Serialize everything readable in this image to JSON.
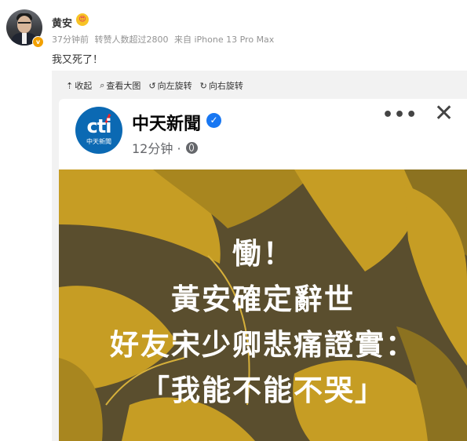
{
  "post": {
    "username": "黄安",
    "emoji_badge": "😍",
    "verified_mark": "v",
    "time": "37分钟前",
    "reposts": "转赞人数超过2800",
    "source": "来自 iPhone 13 Pro Max",
    "text": "我又死了！"
  },
  "toolbar": {
    "collapse": "收起",
    "view_large": "查看大图",
    "rotate_left": "向左旋转",
    "rotate_right": "向右旋转"
  },
  "fb_card": {
    "logo_text": "cti",
    "logo_sub": "中天新聞",
    "page_name": "中天新聞",
    "time": "12分钟 ·",
    "more": "•••",
    "close": "✕"
  },
  "poster": {
    "line1": "慟！",
    "line2": "黃安確定辭世",
    "line3": "好友宋少卿悲痛證實：",
    "line4": "「我能不能不哭」"
  },
  "colors": {
    "poster_dark": "#5a4e2e",
    "poster_gold": "#c69d24",
    "fb_blue": "#1877f2",
    "cti_blue": "#0b69b3"
  }
}
